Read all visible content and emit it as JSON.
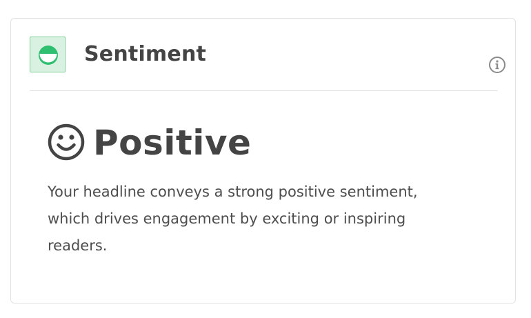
{
  "card": {
    "title": "Sentiment",
    "title_icon": "sentiment-smile-icon",
    "info_icon": "info-icon",
    "result": {
      "icon": "smiley-face-icon",
      "label": "Positive"
    },
    "description": "Your headline conveys a strong positive sentiment, which drives engagement by exciting or inspiring readers."
  },
  "colors": {
    "text_dark": "#444444",
    "text_body": "#4d4d4d",
    "icon_green": "#2fbf71",
    "icon_green_light": "#d8f1e1",
    "border": "#e2e2e2"
  }
}
